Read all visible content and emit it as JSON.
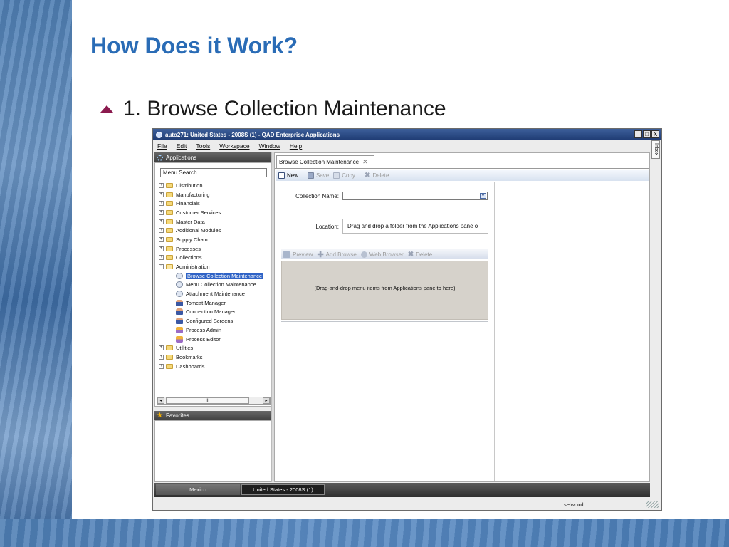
{
  "slide": {
    "title": "How Does it Work?",
    "bullet": "1. Browse Collection Maintenance"
  },
  "window": {
    "title": "auto271: United States - 2008S (1) - QAD Enterprise Applications",
    "controls": [
      "_",
      "□",
      "X"
    ],
    "menu": [
      "File",
      "Edit",
      "Tools",
      "Workspace",
      "Window",
      "Help"
    ],
    "inbox_label": "Inbox"
  },
  "applications": {
    "header": "Applications",
    "search_value": "Menu Search",
    "folders_top": [
      "Distribution",
      "Manufacturing",
      "Financials",
      "Customer Services",
      "Master Data",
      "Additional Modules",
      "Supply Chain",
      "Processes",
      "Collections"
    ],
    "admin_folder": "Administration",
    "admin_items": [
      "Browse Collection Maintenance",
      "Menu Collection Maintenance",
      "Attachment Maintenance",
      "Tomcat Manager",
      "Connection Manager",
      "Configured Screens",
      "Process Admin",
      "Process Editor"
    ],
    "selected_item": "Browse Collection Maintenance",
    "folders_bottom": [
      "Utilities",
      "Bookmarks",
      "Dashboards"
    ],
    "scroll_thumb_label": "III"
  },
  "favorites": {
    "header": "Favorites"
  },
  "document": {
    "tab_label": "Browse Collection Maintenance",
    "toolbar": {
      "new": "New",
      "save": "Save",
      "copy": "Copy",
      "delete": "Delete"
    },
    "collection_name_label": "Collection Name:",
    "collection_name_value": "",
    "location_label": "Location:",
    "location_value": "Drag and drop a folder from the Applications pane o",
    "sub_toolbar": {
      "preview": "Preview",
      "add_browse": "Add Browse",
      "web_browser": "Web Browser",
      "delete": "Delete"
    },
    "drop_hint": "(Drag-and-drop menu items from Applications pane to here)"
  },
  "taskbar": {
    "tasks": [
      "Mexico",
      "United States - 2008S (1)"
    ]
  },
  "statusbar": {
    "user": "selwood"
  },
  "colors": {
    "title_blue": "#2a6cb6",
    "bullet": "#8b1a4e",
    "selection": "#2f63c6"
  }
}
